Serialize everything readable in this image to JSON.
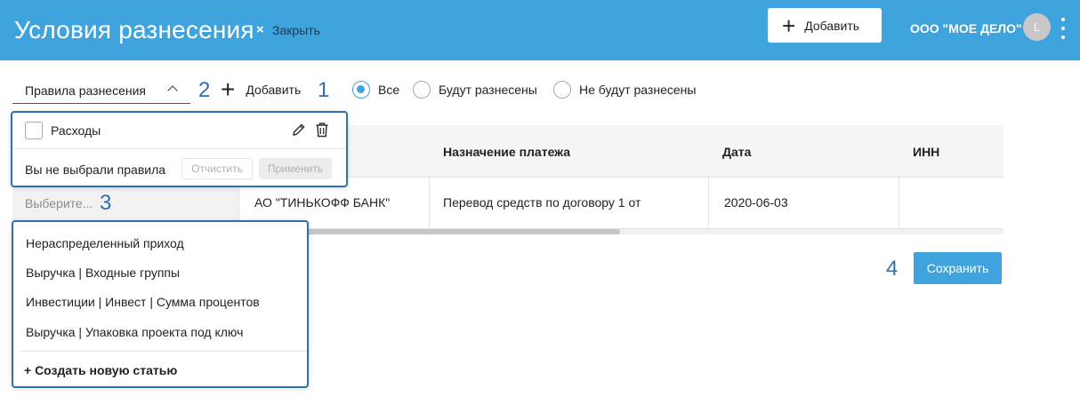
{
  "header": {
    "title": "Условия разнесения",
    "close_icon": "×",
    "close_label": "Закрыть",
    "add_label": "Добавить",
    "org_name": "ООО \"МОЕ ДЕЛО\"",
    "avatar_letter": "L"
  },
  "toolbar": {
    "rules_select": "Правила разнесения",
    "add_label": "Добавить",
    "filters": [
      {
        "label": "Все",
        "selected": true
      },
      {
        "label": "Будут разнесены",
        "selected": false
      },
      {
        "label": "Не будут разнесены",
        "selected": false
      }
    ]
  },
  "annotations": {
    "n1": "1",
    "n2": "2",
    "n3": "3",
    "n4": "4"
  },
  "rules_popup": {
    "rule_name": "Расходы",
    "rule_checked": false,
    "empty_text": "Вы не выбрали правила",
    "clear_label": "Отчистить",
    "apply_label": "Применить"
  },
  "table": {
    "columns": [
      "Назначение платежа",
      "Дата",
      "ИНН"
    ],
    "row": {
      "select_placeholder": "Выберите...",
      "counterparty": "АО \"ТИНЬКОФФ БАНК\"",
      "purpose": "Перевод средств по договору 1 от",
      "date": "2020-06-03",
      "inn": ""
    }
  },
  "dropdown": {
    "items": [
      "Нераспределенный приход",
      "Выручка | Входные группы",
      "Инвестиции | Инвест | Сумма процентов",
      "Выручка | Упаковка проекта под ключ"
    ],
    "create_label": "+ Создать новую статью"
  },
  "save_label": "Сохранить",
  "colors": {
    "accent": "#3fa3dd",
    "highlight": "#2f6fb0"
  }
}
